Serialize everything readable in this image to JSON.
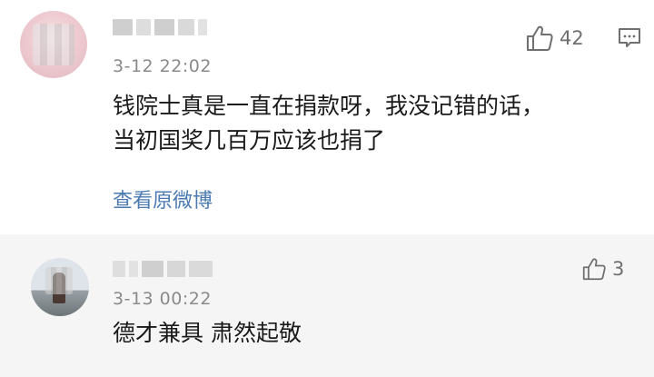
{
  "comments": [
    {
      "time": "3-12 22:02",
      "text_line1": "钱院士真是一直在捐款呀，我没记错的话，",
      "text_line2": "当初国奖几百万应该也捐了",
      "like_count": "42",
      "link": "查看原微博",
      "icons": {
        "like": "thumbs-up-icon",
        "reply": "comment-icon"
      }
    },
    {
      "time": "3-13 00:22",
      "text": "德才兼具 肃然起敬",
      "like_count": "3",
      "icons": {
        "like": "thumbs-up-icon"
      }
    }
  ],
  "colors": {
    "background": "#ffffff",
    "reply_background": "#f5f5f5",
    "link": "#4a7ab1",
    "meta_gray": "#8a8a8a"
  }
}
